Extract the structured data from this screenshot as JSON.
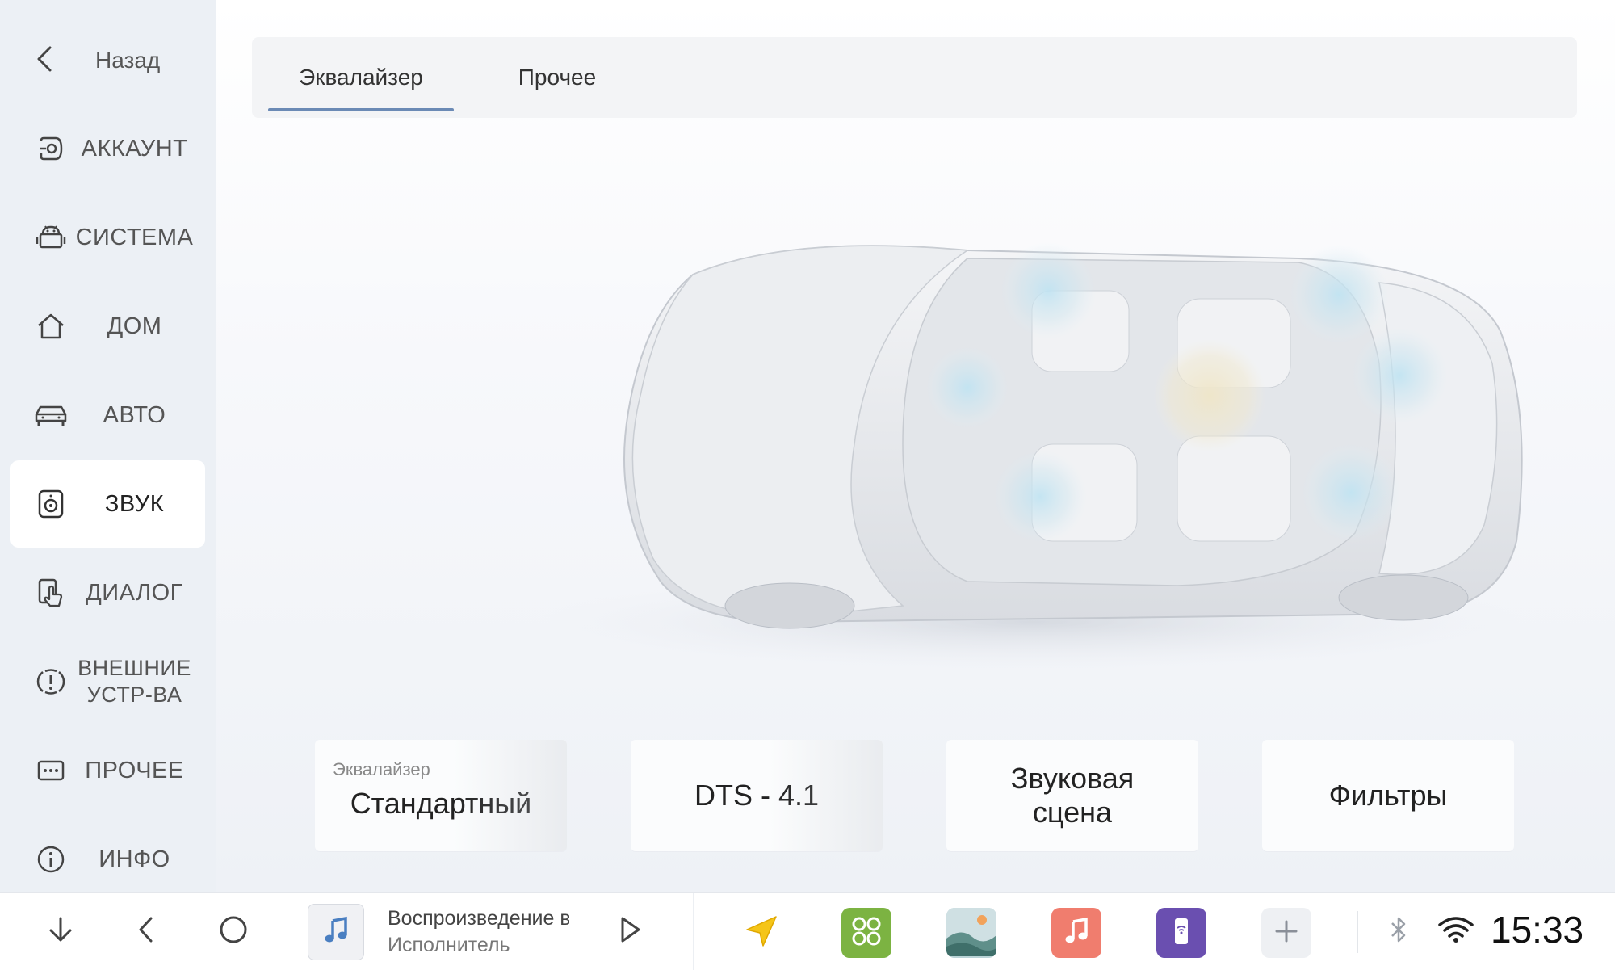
{
  "sidebar": {
    "back_label": "Назад",
    "items": [
      {
        "label": "АККАУНТ",
        "icon": "account-icon"
      },
      {
        "label": "СИСТЕМА",
        "icon": "android-icon"
      },
      {
        "label": "ДОМ",
        "icon": "home-icon"
      },
      {
        "label": "АВТО",
        "icon": "car-icon"
      },
      {
        "label": "ЗВУК",
        "icon": "speaker-icon",
        "active": true
      },
      {
        "label": "ДИАЛОГ",
        "icon": "touch-icon"
      },
      {
        "label": "ВНЕШНИЕ\nУСТР-ВА",
        "icon": "alert-device-icon"
      },
      {
        "label": "ПРОЧЕЕ",
        "icon": "more-icon"
      },
      {
        "label": "ИНФО",
        "icon": "info-icon"
      }
    ]
  },
  "tabs": [
    {
      "label": "Эквалайзер",
      "active": true
    },
    {
      "label": "Прочее",
      "active": false
    }
  ],
  "cards": [
    {
      "small": "Эквалайзер",
      "title": "Стандартный"
    },
    {
      "title": "DTS - 4.1"
    },
    {
      "title": "Звуковая\nсцена"
    },
    {
      "title": "Фильтры"
    }
  ],
  "bottombar": {
    "track_title": "Воспроизведение в процессе",
    "track_artist": "Исполнитель",
    "clock": "15:33",
    "apps": [
      "navigation-icon",
      "apps-icon",
      "gallery-icon",
      "music-app-icon",
      "phone-link-icon",
      "add-icon"
    ]
  },
  "colors": {
    "accent": "#6b8ab5",
    "music_app": "#f07d6e",
    "apps_green": "#7cb342",
    "phone_link": "#6a4fb0",
    "navigation": "#f5c518"
  }
}
